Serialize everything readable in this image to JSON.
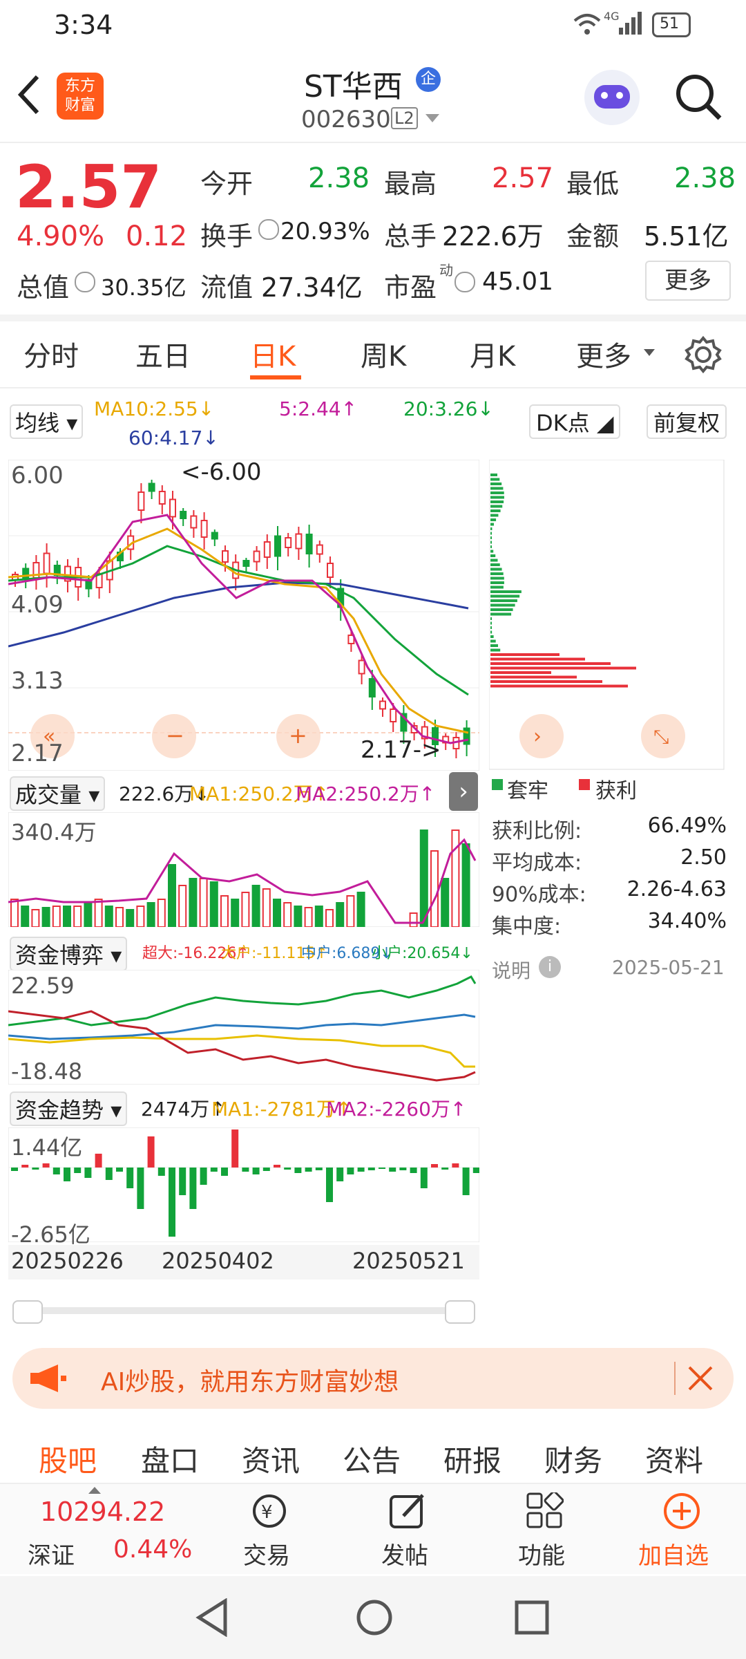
{
  "status": {
    "time": "3:34",
    "network": "4G",
    "battery": "51"
  },
  "nav": {
    "title": "ST华西",
    "badge": "企",
    "code": "002630",
    "level": "L2",
    "logo_line1": "东方",
    "logo_line2": "财富"
  },
  "quote": {
    "price": "2.57",
    "change_pct": "4.90%",
    "change": "0.12",
    "open_label": "今开",
    "open": "2.38",
    "high_label": "最高",
    "high": "2.57",
    "low_label": "最低",
    "low": "2.38",
    "turnover_label": "换手",
    "turnover": "20.93%",
    "volume_label": "总手",
    "volume": "222.6万",
    "amount_label": "金额",
    "amount": "5.51亿",
    "mktcap_label": "总值",
    "mktcap": "30.35亿",
    "float_label": "流值",
    "float": "27.34亿",
    "pe_label": "市盈",
    "pe_sup": "动",
    "pe": "45.01",
    "more_button": "更多"
  },
  "tabs": [
    "分时",
    "五日",
    "日K",
    "周K",
    "月K",
    "更多"
  ],
  "ma": {
    "selector": "均线",
    "ma10": "MA10:2.55↓",
    "ma5": "5:2.44↑",
    "ma20": "20:3.26↓",
    "ma60": "60:4.17↓",
    "dk": "DK点",
    "fq": "前复权"
  },
  "kline": {
    "y_top": "6.00",
    "y2": "4.09",
    "y3": "3.13",
    "y_bottom": "2.17",
    "high_mark": "<-6.00",
    "low_mark": "2.17->"
  },
  "volume": {
    "selector": "成交量",
    "value": "222.6万↓",
    "ma1": "MA1:250.2万↑",
    "ma2": "MA2:250.2万↑",
    "max": "340.4万"
  },
  "capital": {
    "selector": "资金博弈",
    "super": "超大:-16.226↑",
    "big": "大户:-11.115↑",
    "mid": "中户:6.689↓",
    "small": "小户:20.654↓",
    "top": "22.59",
    "bottom": "-18.48"
  },
  "trend": {
    "selector": "资金趋势",
    "value": "2474万↑",
    "ma1": "MA1:-2781万↑",
    "ma2": "MA2:-2260万↑",
    "top": "1.44亿",
    "bottom": "-2.65亿"
  },
  "dates": [
    "20250226",
    "20250402",
    "20250521"
  ],
  "chips": {
    "legend_trapped": "套牢",
    "legend_profit": "获利",
    "rows": [
      {
        "label": "获利比例:",
        "value": "66.49%"
      },
      {
        "label": "平均成本:",
        "value": "2.50"
      },
      {
        "label": "90%成本:",
        "value": "2.26-4.63"
      },
      {
        "label": "集中度:",
        "value": "34.40%"
      }
    ],
    "note_label": "说明",
    "date": "2025-05-21"
  },
  "banner": {
    "text": "AI炒股，就用东方财富妙想"
  },
  "bottom_tabs": [
    "股吧",
    "盘口",
    "资讯",
    "公告",
    "研报",
    "财务",
    "资料"
  ],
  "toolbar": {
    "index_value": "10294.22",
    "index_name": "深证",
    "index_change": "0.44%",
    "trade": "交易",
    "post": "发帖",
    "func": "功能",
    "add": "加自选"
  },
  "colors": {
    "up": "#e8313a",
    "down": "#12a33a",
    "accent": "#ff6a1a"
  }
}
